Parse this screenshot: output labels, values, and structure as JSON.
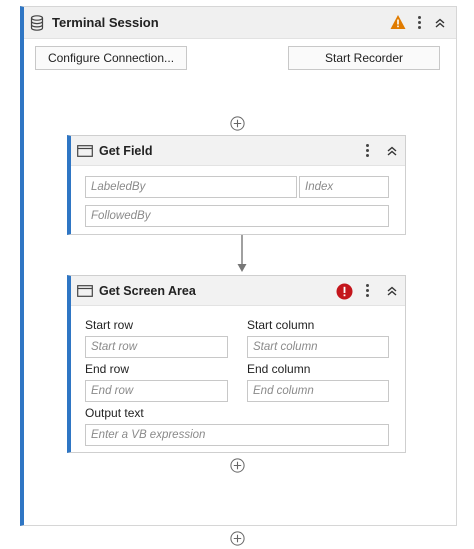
{
  "session": {
    "title": "Terminal Session",
    "configure_label": "Configure Connection...",
    "start_recorder_label": "Start Recorder"
  },
  "get_field": {
    "title": "Get Field",
    "labeled_by_placeholder": "LabeledBy",
    "index_placeholder": "Index",
    "followed_by_placeholder": "FollowedBy"
  },
  "get_screen_area": {
    "title": "Get Screen Area",
    "start_row_label": "Start row",
    "start_row_placeholder": "Start row",
    "start_column_label": "Start column",
    "start_column_placeholder": "Start column",
    "end_row_label": "End row",
    "end_row_placeholder": "End row",
    "end_column_label": "End column",
    "end_column_placeholder": "End column",
    "output_text_label": "Output text",
    "output_text_placeholder": "Enter a VB expression"
  },
  "colors": {
    "accent": "#2f76c4",
    "warning": "#e07b00",
    "error": "#c4161c"
  },
  "icons": [
    "database-icon",
    "warning-icon",
    "more-options-icon",
    "collapse-icon",
    "add-activity-icon",
    "screen-icon",
    "error-icon",
    "arrow-down-icon"
  ]
}
